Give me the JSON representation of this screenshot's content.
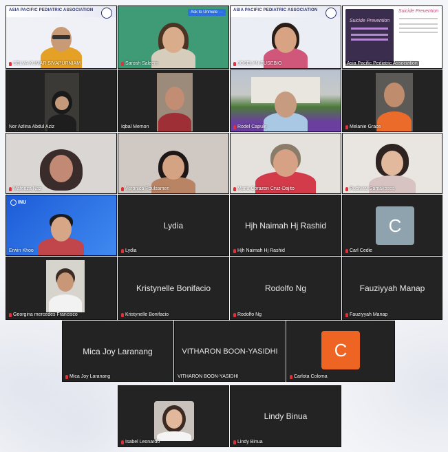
{
  "row1": {
    "t1": {
      "banner": "ASIA PACIFIC PEDIATRIC ASSOCIATION",
      "name": "SELVA KUMAR SIVAPURNIAM"
    },
    "t2": {
      "unmute": "Ask to Unmute",
      "more": "···",
      "name": "Sarosh Saleem"
    },
    "t3": {
      "banner": "ASIA PACIFIC PEDIATRIC ASSOCIATION",
      "name": "JOSELYN EUSEBIO"
    },
    "t4": {
      "slide_title": "Suicide Prevention",
      "slide_title_right": "Suicide Prevention",
      "name": "Asia Pacific Pediatric Association"
    }
  },
  "row2": {
    "t1": {
      "name": "Nor Azlina Abdul Aziz"
    },
    "t2": {
      "name": "Iqbal Memon"
    },
    "t3": {
      "name": "Rodel Capule"
    },
    "t4": {
      "name": "Melanie Grace"
    }
  },
  "row3": {
    "t1": {
      "name": "Mafeeza Naz"
    },
    "t2": {
      "name": "Veronica Poulsamen"
    },
    "t3": {
      "name": "Maria Corazon Cruz-Dajito"
    },
    "t4": {
      "name": "Rudiwiat Samakoses"
    }
  },
  "row4": {
    "t1": {
      "logo": "INU",
      "name": "Erwin Khoo"
    },
    "t2": {
      "display": "Lydia",
      "name": "Lydia"
    },
    "t3": {
      "display": "Hjh Naimah Hj Rashid",
      "name": "Hjh Naimah Hj Rashid"
    },
    "t4": {
      "initial": "C",
      "name": "Carl Cedie",
      "avatar_color": "#8ea3ad"
    }
  },
  "row5": {
    "t1": {
      "name": "Georgina mercedes Francisco"
    },
    "t2": {
      "display": "Kristynelle Bonifacio",
      "name": "Kristynelle Bonifacio"
    },
    "t3": {
      "display": "Rodolfo Ng",
      "name": "Rodolfo Ng"
    },
    "t4": {
      "display": "Fauziyyah Manap",
      "name": "Fauziyyah Manap"
    }
  },
  "row6": {
    "t1": {
      "display": "Mica Joy Laranang",
      "name": "Mica Joy Laranang"
    },
    "t2": {
      "display": "VITHARON BOON-YASIDHI",
      "name": "VITHARON BOON-YASIDHI"
    },
    "t3": {
      "initial": "C",
      "name": "Carlota Coloma",
      "avatar_color": "#ee6423"
    }
  },
  "row7": {
    "t1": {
      "name": "Isabel Leonardo"
    },
    "t2": {
      "display": "Lindy Binua",
      "name": "Lindy Binua"
    }
  },
  "icons": {
    "mic_muted": "mic-muted-icon"
  }
}
